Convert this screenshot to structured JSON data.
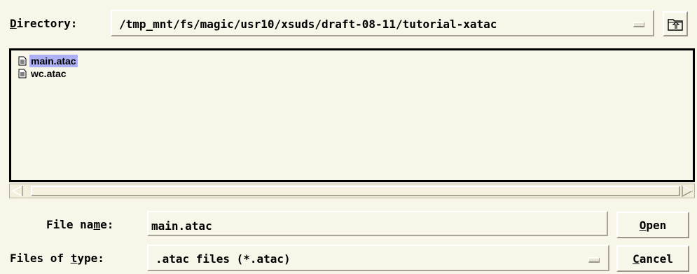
{
  "directory": {
    "label_pre": "",
    "label_mnemonic": "D",
    "label_post": "irectory:",
    "path": "/tmp_mnt/fs/magic/usr10/xsuds/draft-08-11/tutorial-xatac"
  },
  "files": [
    {
      "name": "main.atac",
      "selected": true
    },
    {
      "name": "wc.atac",
      "selected": false
    }
  ],
  "file_name": {
    "label_pre": "File na",
    "label_mnemonic": "m",
    "label_post": "e:",
    "value": "main.atac"
  },
  "file_type": {
    "label_pre": "Files of ",
    "label_mnemonic": "t",
    "label_post": "ype:",
    "value": ".atac files (*.atac)"
  },
  "buttons": {
    "open_mnemonic": "O",
    "open_rest": "pen",
    "cancel_mnemonic": "C",
    "cancel_rest": "ancel"
  },
  "colors": {
    "background": "#f8f6e8",
    "selection": "#aeb0f5"
  },
  "icons": {
    "file": "file-icon",
    "up_folder": "up-folder-icon",
    "combo_arrow": "dropdown-arrow-icon"
  }
}
